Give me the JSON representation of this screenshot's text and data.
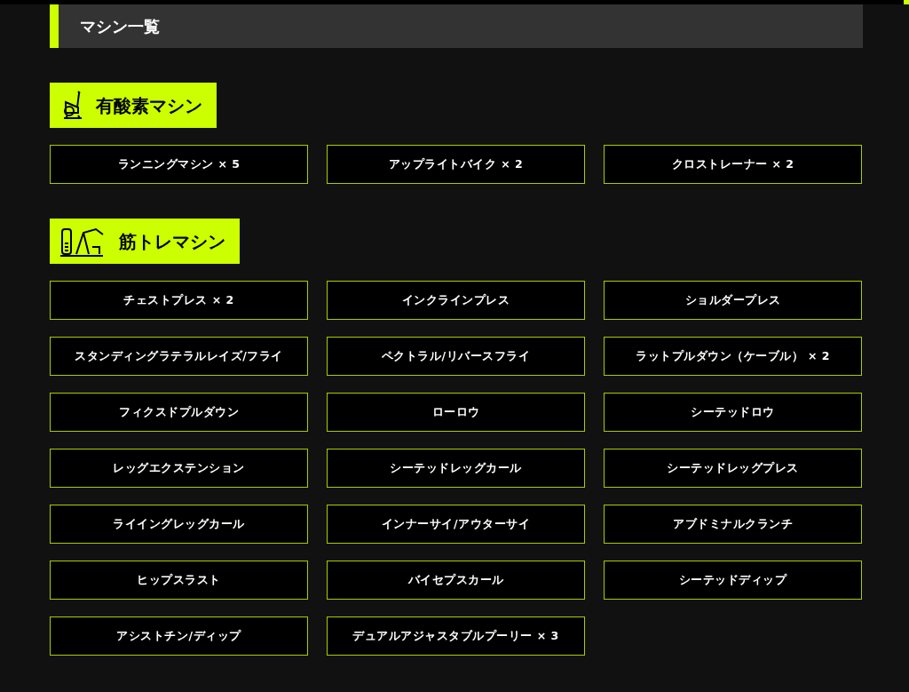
{
  "heading": "マシン一覧",
  "sections": [
    {
      "title": "有酸素マシン",
      "kind": "cardio",
      "items": [
        "ランニングマシン × 5",
        "アップライトバイク × 2",
        "クロストレーナー × 2"
      ]
    },
    {
      "title": "筋トレマシン",
      "kind": "strength",
      "items": [
        "チェストプレス × 2",
        "インクラインプレス",
        "ショルダープレス",
        "スタンディングラテラルレイズ/フライ",
        "ペクトラル/リバースフライ",
        "ラットプルダウン（ケーブル） × 2",
        "フィクスドプルダウン",
        "ローロウ",
        "シーテッドロウ",
        "レッグエクステンション",
        "シーテッドレッグカール",
        "シーテッドレッグプレス",
        "ライイングレッグカール",
        "インナーサイ/アウターサイ",
        "アブドミナルクランチ",
        "ヒップスラスト",
        "バイセプスカール",
        "シーテッドディップ",
        "アシストチン/ディップ",
        "デュアルアジャスタブルプーリー × 3"
      ]
    }
  ]
}
